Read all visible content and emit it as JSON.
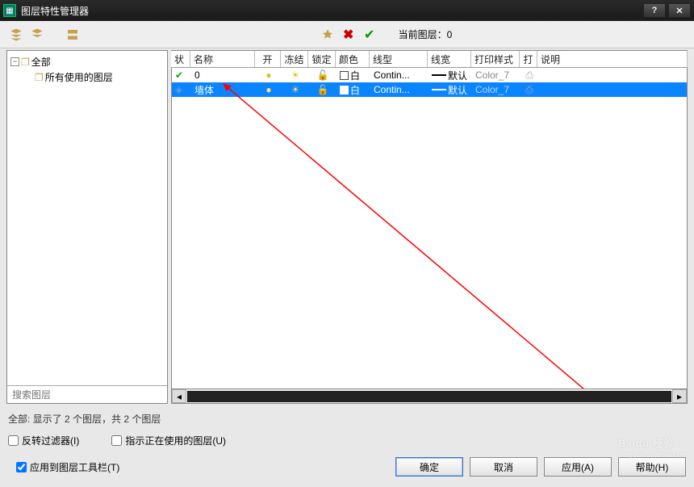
{
  "window": {
    "title": "图层特性管理器"
  },
  "toolbar": {
    "current_layer_label": "当前图层：",
    "current_layer_value": "0"
  },
  "tree": {
    "root": {
      "label": "全部"
    },
    "child": {
      "label": "所有使用的图层"
    }
  },
  "search": {
    "placeholder": "搜索图层"
  },
  "columns": {
    "status": "状",
    "name": "名称",
    "on": "开",
    "freeze": "冻结",
    "lock": "锁定",
    "color": "颜色",
    "ltype": "线型",
    "lweight": "线宽",
    "pstyle": "打印样式",
    "plot": "打",
    "desc": "说明"
  },
  "rows": [
    {
      "status": "current",
      "name": "0",
      "on": true,
      "freeze": false,
      "lock": false,
      "color": "白",
      "ltype": "Contin...",
      "lweight": "默认",
      "pstyle": "Color_7",
      "plot": true,
      "selected": false
    },
    {
      "status": "normal",
      "name": "墙体",
      "on": true,
      "freeze": false,
      "lock": false,
      "color": "白",
      "ltype": "Contin...",
      "lweight": "默认",
      "pstyle": "Color_7",
      "plot": true,
      "selected": true
    }
  ],
  "status_line": "全部: 显示了 2 个图层，共 2 个图层",
  "checks": {
    "invert": {
      "label": "反转过滤器(I)",
      "checked": false
    },
    "inuse": {
      "label": "指示正在使用的图层(U)",
      "checked": false
    },
    "applytb": {
      "label": "应用到图层工具栏(T)",
      "checked": true
    }
  },
  "buttons": {
    "ok": "确定",
    "cancel": "取消",
    "apply": "应用(A)",
    "help": "帮助(H)"
  },
  "watermark": {
    "brand": "Baidu 经验",
    "url": "jingyan.baidu.com"
  }
}
